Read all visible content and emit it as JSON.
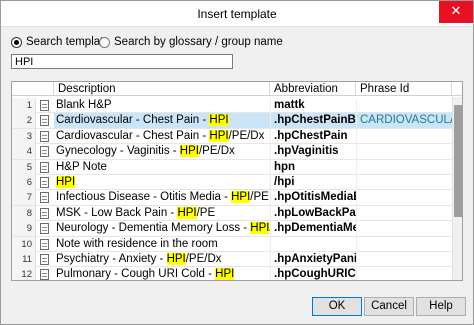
{
  "window": {
    "title": "Insert template",
    "close_glyph": "✕"
  },
  "search": {
    "option_template": "Search template",
    "option_glossary": "Search by glossary / group name",
    "query": "HPI"
  },
  "columns": {
    "description": "Description",
    "abbreviation": "Abbreviation",
    "phrase_id": "Phrase Id"
  },
  "rows": [
    {
      "num": "1",
      "pre": "Blank H&P",
      "hl": "",
      "post": "",
      "abbr": "mattk",
      "phrase": ""
    },
    {
      "num": "2",
      "pre": "Cardiovascular - Chest Pain - ",
      "hl": "HPI",
      "post": "",
      "abbr": ".hpChestPainBRIEF",
      "phrase": "CARDIOVASCULAR-..."
    },
    {
      "num": "3",
      "pre": "Cardiovascular - Chest Pain - ",
      "hl": "HPI",
      "post": "/PE/Dx",
      "abbr": ".hpChestPain",
      "phrase": ""
    },
    {
      "num": "4",
      "pre": "Gynecology - Vaginitis - ",
      "hl": "HPI",
      "post": "/PE/Dx",
      "abbr": ".hpVaginitis",
      "phrase": ""
    },
    {
      "num": "5",
      "pre": "H&P Note",
      "hl": "",
      "post": "",
      "abbr": "hpn",
      "phrase": ""
    },
    {
      "num": "6",
      "pre": "",
      "hl": "HPI",
      "post": "",
      "abbr": "/hpi",
      "phrase": ""
    },
    {
      "num": "7",
      "pre": "Infectious Disease - Otitis Media - ",
      "hl": "HPI",
      "post": "/PE",
      "abbr": ".hpOtitisMediaEar...",
      "phrase": ""
    },
    {
      "num": "8",
      "pre": "MSK - Low Back Pain - ",
      "hl": "HPI",
      "post": "/PE",
      "abbr": ".hpLowBackPain",
      "phrase": ""
    },
    {
      "num": "9",
      "pre": "Neurology - Dementia Memory Loss - ",
      "hl": "HPI",
      "post": "/PE",
      "abbr": ".hpDementiaMem...",
      "phrase": ""
    },
    {
      "num": "10",
      "pre": "Note with residence in the room",
      "hl": "",
      "post": "",
      "abbr": "",
      "phrase": ""
    },
    {
      "num": "11",
      "pre": "Psychiatry - Anxiety - ",
      "hl": "HPI",
      "post": "/PE/Dx",
      "abbr": ".hpAnxietyPanicA...",
      "phrase": ""
    },
    {
      "num": "12",
      "pre": "Pulmonary - Cough URI Cold - ",
      "hl": "HPI",
      "post": "",
      "abbr": ".hpCoughURICold...",
      "phrase": ""
    }
  ],
  "selected_row_index": 1,
  "buttons": {
    "ok": "OK",
    "cancel": "Cancel",
    "help": "Help"
  },
  "colors": {
    "highlight": "#ffff00",
    "selection": "#cce4f7",
    "phrase_text": "#1a7f8a",
    "close": "#e81123"
  }
}
